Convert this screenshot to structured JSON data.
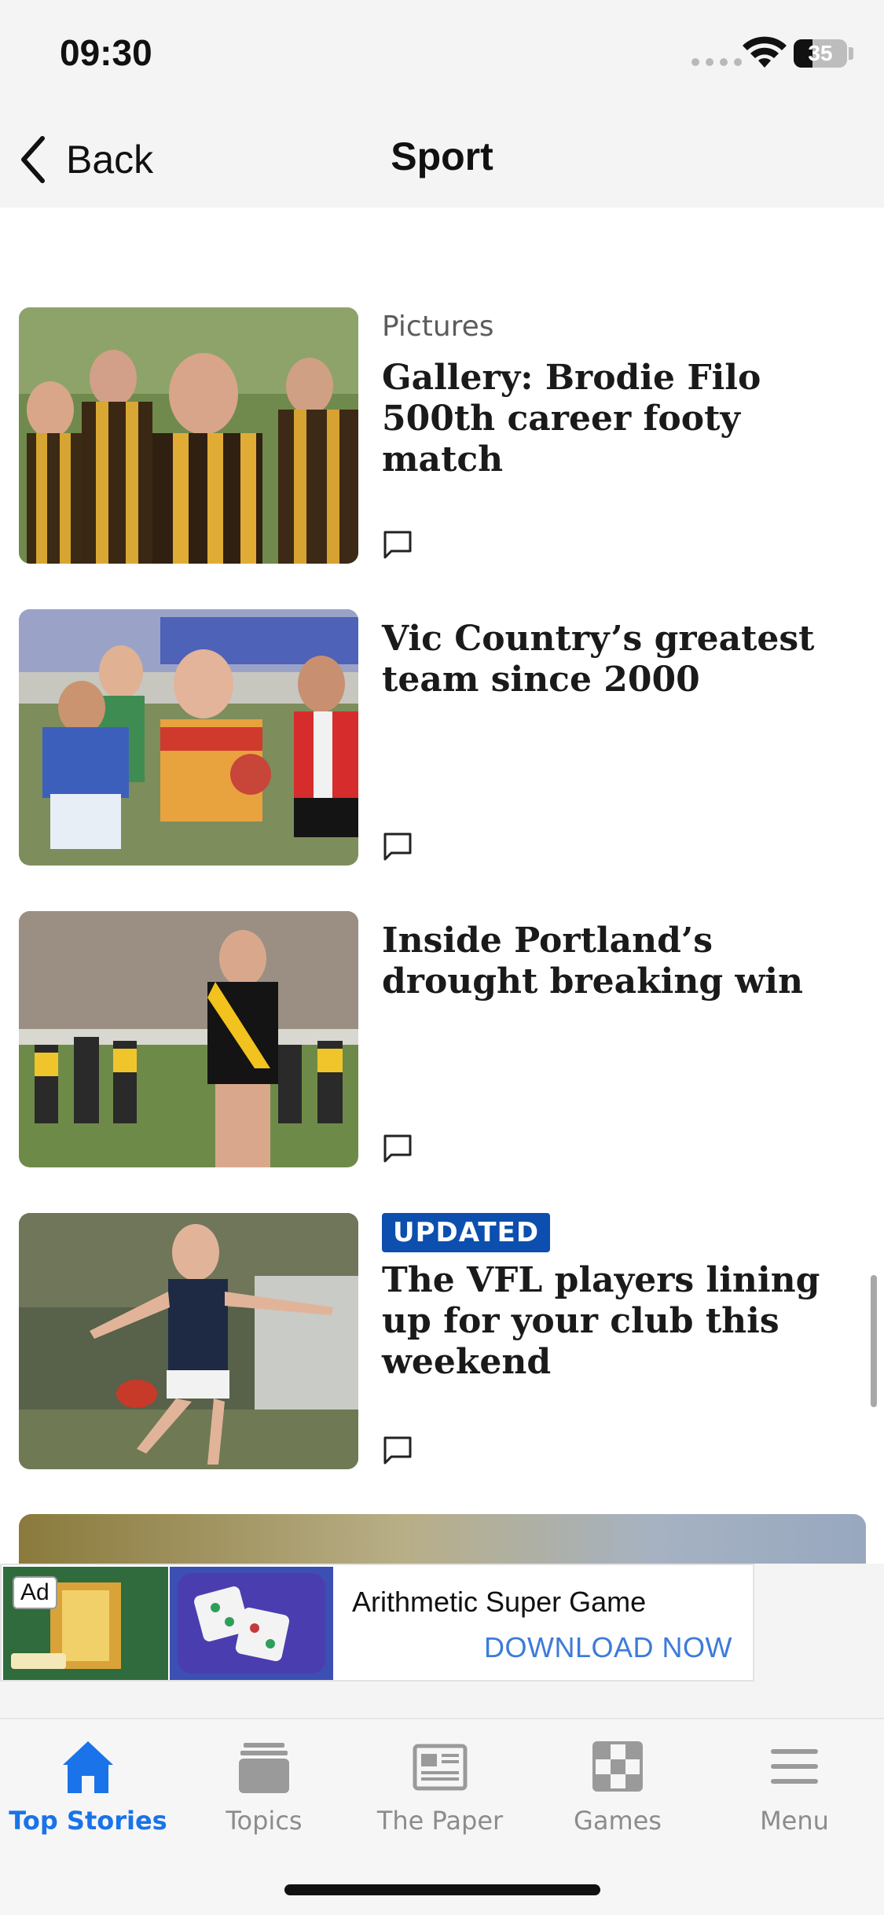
{
  "status_bar": {
    "time": "09:30",
    "battery_level": "35",
    "wifi_icon": "wifi-icon",
    "signal_icon": "cellular-signal-icon"
  },
  "nav": {
    "back_label": "Back",
    "back_icon": "chevron-left-icon",
    "title": "Sport"
  },
  "articles": [
    {
      "kicker": "Pictures",
      "badge": "",
      "headline": "Gallery: Brodie Filo 500th career footy match",
      "comment_icon": "comment-bubble-icon"
    },
    {
      "kicker": "",
      "badge": "",
      "headline": "Vic Country’s greatest team since 2000",
      "comment_icon": "comment-bubble-icon"
    },
    {
      "kicker": "",
      "badge": "",
      "headline": "Inside Portland’s drought breaking win",
      "comment_icon": "comment-bubble-icon"
    },
    {
      "kicker": "",
      "badge": "UPDATED",
      "headline": "The VFL players lining up for your club this weekend",
      "comment_icon": "comment-bubble-icon"
    }
  ],
  "ad": {
    "badge": "Ad",
    "title": "Arithmetic Super Game",
    "cta": "DOWNLOAD NOW"
  },
  "tabs": [
    {
      "label": "Top Stories",
      "icon": "home-icon",
      "active": true
    },
    {
      "label": "Topics",
      "icon": "stack-icon",
      "active": false
    },
    {
      "label": "The Paper",
      "icon": "newspaper-icon",
      "active": false
    },
    {
      "label": "Games",
      "icon": "checkerboard-icon",
      "active": false
    },
    {
      "label": "Menu",
      "icon": "hamburger-menu-icon",
      "active": false
    }
  ],
  "colors": {
    "accent": "#1a73e8",
    "badge": "#0c4fae",
    "ad_cta": "#3d7bd8",
    "bar_background": "#f4f4f4"
  }
}
